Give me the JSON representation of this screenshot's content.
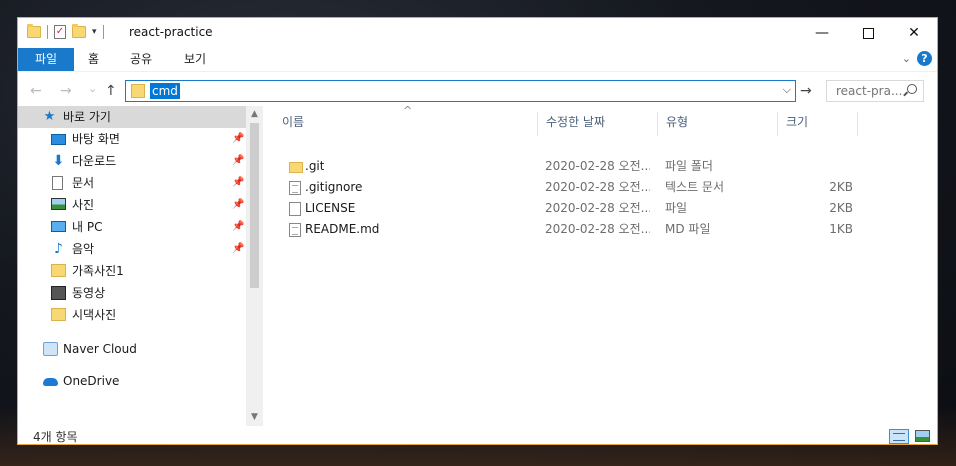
{
  "window": {
    "title": "react-practice",
    "accent_color": "#e8a53b",
    "controls": {
      "minimize": "—",
      "close": "✕"
    }
  },
  "ribbon": {
    "file_tab": "파일",
    "tabs": [
      "홈",
      "공유",
      "보기"
    ],
    "collapse_icon": "chevron-down-icon",
    "help_label": "?"
  },
  "nav": {
    "back": "←",
    "forward": "→",
    "recent": "⌄",
    "up": "↑",
    "address_value": "cmd",
    "address_dropdown": "⌵",
    "go": "→",
    "search_placeholder": "react-pra..."
  },
  "sidebar": {
    "items": [
      {
        "label": "바로 가기",
        "icon": "star-icon",
        "pinned": false
      },
      {
        "label": "바탕 화면",
        "icon": "desktop-icon",
        "pinned": true
      },
      {
        "label": "다운로드",
        "icon": "download-icon",
        "pinned": true
      },
      {
        "label": "문서",
        "icon": "document-icon",
        "pinned": true
      },
      {
        "label": "사진",
        "icon": "pictures-icon",
        "pinned": true
      },
      {
        "label": "내 PC",
        "icon": "pc-icon",
        "pinned": true
      },
      {
        "label": "음악",
        "icon": "music-icon",
        "pinned": true
      },
      {
        "label": "가족사진1",
        "icon": "folder-icon",
        "pinned": false
      },
      {
        "label": "동영상",
        "icon": "video-icon",
        "pinned": false
      },
      {
        "label": "시댁사진",
        "icon": "folder-icon",
        "pinned": false
      },
      {
        "label": "Naver Cloud",
        "icon": "naver-cloud-icon",
        "pinned": false
      },
      {
        "label": "OneDrive",
        "icon": "onedrive-icon",
        "pinned": false
      }
    ],
    "pin_glyph": "📌",
    "star_glyph": "★",
    "download_glyph": "⬇",
    "music_glyph": "♪"
  },
  "columns": {
    "name": "이름",
    "modified": "수정한 날짜",
    "type": "유형",
    "size": "크기",
    "sort_caret": "^"
  },
  "files": [
    {
      "name": ".git",
      "modified": "2020-02-28 오전...",
      "type": "파일 폴더",
      "size": "",
      "icon": "folder-icon"
    },
    {
      "name": ".gitignore",
      "modified": "2020-02-28 오전...",
      "type": "텍스트 문서",
      "size": "2KB",
      "icon": "text-file-icon"
    },
    {
      "name": "LICENSE",
      "modified": "2020-02-28 오전...",
      "type": "파일",
      "size": "2KB",
      "icon": "file-icon"
    },
    {
      "name": "README.md",
      "modified": "2020-02-28 오전...",
      "type": "MD 파일",
      "size": "1KB",
      "icon": "text-file-icon"
    }
  ],
  "status": {
    "item_count": "4개 항목"
  }
}
